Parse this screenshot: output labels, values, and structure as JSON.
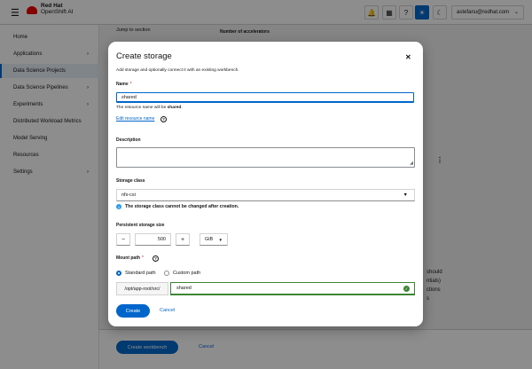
{
  "masthead": {
    "brand_line1": "Red Hat",
    "brand_line2": "OpenShift AI",
    "user": "astefanu@redhat.com"
  },
  "sidebar": {
    "items": [
      {
        "label": "Home",
        "has_caret": false
      },
      {
        "label": "Applications",
        "has_caret": true
      },
      {
        "label": "Data Science Projects",
        "has_caret": false,
        "active": true
      },
      {
        "label": "Data Science Pipelines",
        "has_caret": true
      },
      {
        "label": "Experiments",
        "has_caret": true
      },
      {
        "label": "Distributed Workload Metrics",
        "has_caret": false
      },
      {
        "label": "Model Serving",
        "has_caret": false
      },
      {
        "label": "Resources",
        "has_caret": false
      },
      {
        "label": "Settings",
        "has_caret": true
      }
    ]
  },
  "background": {
    "jump_to_section": "Jump to section",
    "accelerators_label": "Number of accelerators",
    "fragments": [
      "should",
      "ntials)",
      "ctions",
      "s"
    ],
    "create_workbench": "Create workbench",
    "cancel": "Cancel"
  },
  "modal": {
    "title": "Create storage",
    "description": "Add storage and optionally connect it with an existing workbench.",
    "name_label": "Name",
    "name_value": "shared",
    "name_helper_prefix": "The resource name will be ",
    "name_helper_value": "shared",
    "name_helper_suffix": ".",
    "edit_resource_name": "Edit resource name",
    "description_label": "Description",
    "storage_class_label": "Storage class",
    "storage_class_value": "nfs-csi",
    "storage_class_info": "The storage class cannot be changed after creation.",
    "size_label": "Persistent storage size",
    "size_value": "500",
    "size_unit": "GiB",
    "mount_path_label": "Mount path",
    "radio_standard": "Standard path",
    "radio_custom": "Custom path",
    "path_prefix": "/opt/app-root/src/",
    "path_value": "shared",
    "create_label": "Create",
    "cancel_label": "Cancel"
  }
}
